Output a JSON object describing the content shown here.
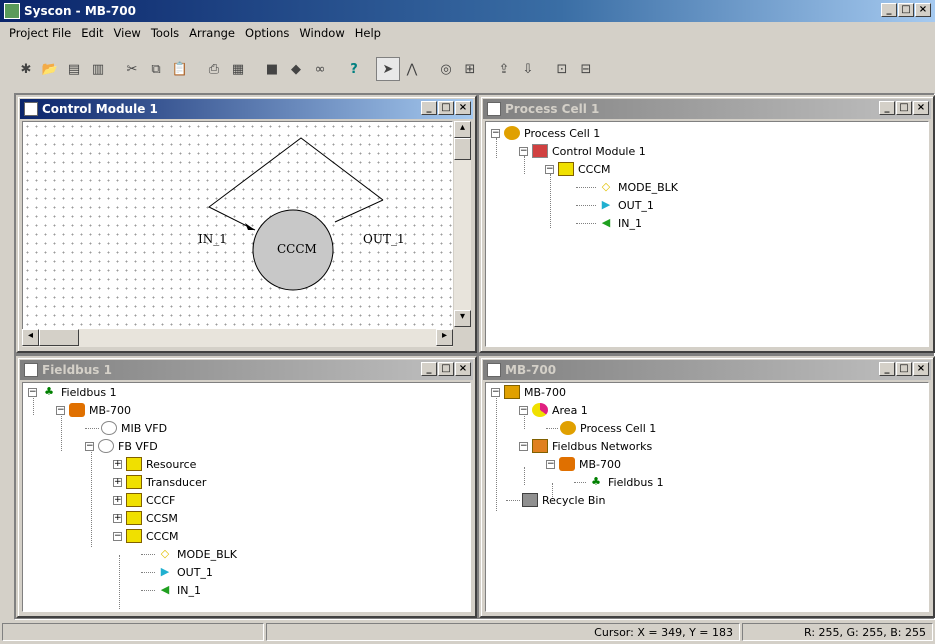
{
  "app": {
    "title": "Syscon - MB-700"
  },
  "menu": [
    "Project File",
    "Edit",
    "View",
    "Tools",
    "Arrange",
    "Options",
    "Window",
    "Help"
  ],
  "windows": {
    "control_module": {
      "title": "Control Module 1",
      "block_label": "CCCM",
      "in_label": "IN_1",
      "out_label": "OUT_1"
    },
    "process_cell": {
      "title": "Process Cell 1",
      "tree": [
        "Process Cell 1",
        "Control Module 1",
        "CCCM",
        "MODE_BLK",
        "OUT_1",
        "IN_1"
      ]
    },
    "fieldbus": {
      "title": "Fieldbus 1",
      "tree": [
        "Fieldbus 1",
        "MB-700",
        "MIB VFD",
        "FB VFD",
        "Resource",
        "Transducer",
        "CCCF",
        "CCSM",
        "CCCM",
        "MODE_BLK",
        "OUT_1",
        "IN_1"
      ]
    },
    "mb700": {
      "title": "MB-700",
      "tree": [
        "MB-700",
        "Area 1",
        "Process Cell 1",
        "Fieldbus Networks",
        "MB-700",
        "Fieldbus 1",
        "Recycle Bin"
      ]
    }
  },
  "status": {
    "cursor": "Cursor: X = 349, Y = 183",
    "color": "R: 255, G: 255, B: 255"
  }
}
